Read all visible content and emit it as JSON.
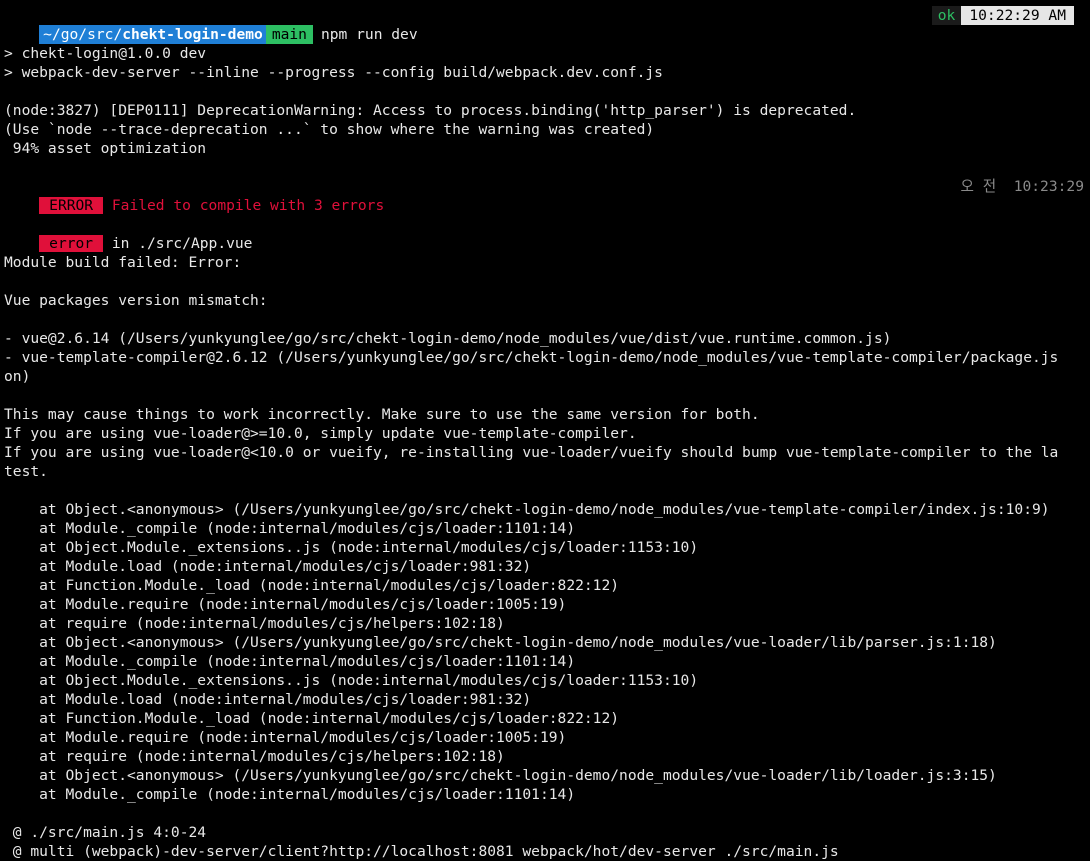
{
  "prompt": {
    "path_prefix": "~/go/src/",
    "path_bold": "chekt-login-demo",
    "branch": "main",
    "command": "npm run dev",
    "status": "ok",
    "clock": "10:22:29 AM"
  },
  "output": {
    "script_line1": "> chekt-login@1.0.0 dev",
    "script_line2": "> webpack-dev-server --inline --progress --config build/webpack.dev.conf.js",
    "warn_line1": "(node:3827) [DEP0111] DeprecationWarning: Access to process.binding('http_parser') is deprecated.",
    "warn_line2": "(Use `node --trace-deprecation ...` to show where the warning was created)",
    "progress_line": " 94% asset optimization",
    "error_badge": "ERROR",
    "error_message": " Failed to compile with 3 errors",
    "error_timestamp": "오 전  10:23:29",
    "error_badge_small": "error",
    "error_location": " in ./src/App.vue",
    "module_build_failed": "Module build failed: Error:",
    "mismatch_title": "Vue packages version mismatch:",
    "vue_version_line": "- vue@2.6.14 (/Users/yunkyunglee/go/src/chekt-login-demo/node_modules/vue/dist/vue.runtime.common.js)",
    "compiler_version_line1": "- vue-template-compiler@2.6.12 (/Users/yunkyunglee/go/src/chekt-login-demo/node_modules/vue-template-compiler/package.js",
    "compiler_version_line2": "on)",
    "advice_line1": "This may cause things to work incorrectly. Make sure to use the same version for both.",
    "advice_line2": "If you are using vue-loader@>=10.0, simply update vue-template-compiler.",
    "advice_line3": "If you are using vue-loader@<10.0 or vueify, re-installing vue-loader/vueify should bump vue-template-compiler to the la",
    "advice_line4": "test.",
    "stack": [
      "    at Object.<anonymous> (/Users/yunkyunglee/go/src/chekt-login-demo/node_modules/vue-template-compiler/index.js:10:9)",
      "    at Module._compile (node:internal/modules/cjs/loader:1101:14)",
      "    at Object.Module._extensions..js (node:internal/modules/cjs/loader:1153:10)",
      "    at Module.load (node:internal/modules/cjs/loader:981:32)",
      "    at Function.Module._load (node:internal/modules/cjs/loader:822:12)",
      "    at Module.require (node:internal/modules/cjs/loader:1005:19)",
      "    at require (node:internal/modules/cjs/helpers:102:18)",
      "    at Object.<anonymous> (/Users/yunkyunglee/go/src/chekt-login-demo/node_modules/vue-loader/lib/parser.js:1:18)",
      "    at Module._compile (node:internal/modules/cjs/loader:1101:14)",
      "    at Object.Module._extensions..js (node:internal/modules/cjs/loader:1153:10)",
      "    at Module.load (node:internal/modules/cjs/loader:981:32)",
      "    at Function.Module._load (node:internal/modules/cjs/loader:822:12)",
      "    at Module.require (node:internal/modules/cjs/loader:1005:19)",
      "    at require (node:internal/modules/cjs/helpers:102:18)",
      "    at Object.<anonymous> (/Users/yunkyunglee/go/src/chekt-login-demo/node_modules/vue-loader/lib/loader.js:3:15)",
      "    at Module._compile (node:internal/modules/cjs/loader:1101:14)"
    ],
    "origin_line1": " @ ./src/main.js 4:0-24",
    "origin_line2": " @ multi (webpack)-dev-server/client?http://localhost:8081 webpack/hot/dev-server ./src/main.js"
  },
  "colors": {
    "path_bg": "#1f7fd6",
    "branch_bg": "#2dbf63",
    "error_red": "#e0103a",
    "clock_bg": "#e6e6e6"
  }
}
